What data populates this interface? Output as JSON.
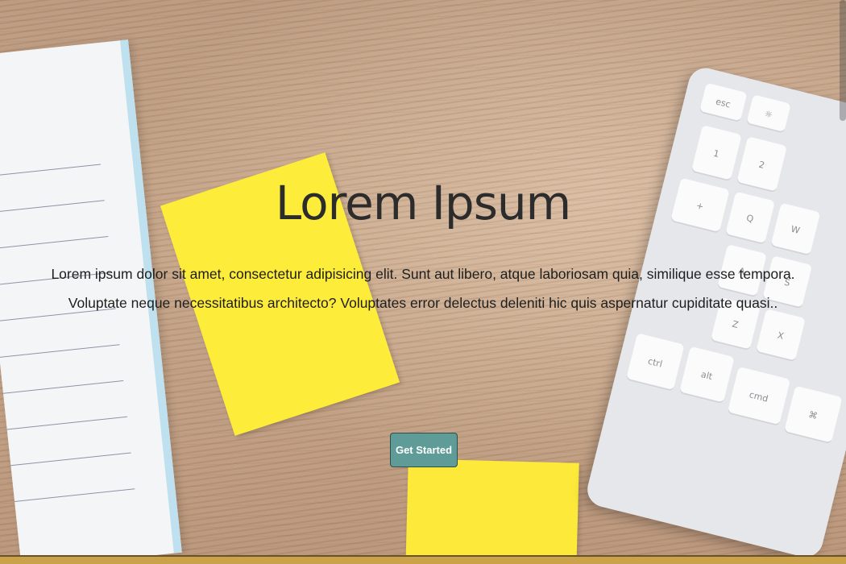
{
  "hero": {
    "title": "Lorem Ipsum",
    "description": "Lorem ipsum dolor sit amet, consectetur adipisicing elit. Sunt aut libero, atque laboriosam quia, similique esse tempora. Voluptate neque necessitatibus architecto? Voluptates error delectus deleniti hic quis aspernatur cupiditate quasi..",
    "cta_label": "Get Started"
  },
  "keyboard_keys": [
    "esc",
    "☼",
    "1",
    "2",
    "+",
    "Q",
    "W",
    "A",
    "S",
    "Z",
    "X",
    "ctrl",
    "alt",
    "cmd",
    "⌘"
  ],
  "colors": {
    "cta_background": "#5f9c97",
    "sticky_note": "#fdec3a",
    "footer_bar": "#caa24a",
    "title_text": "#2c2c2c"
  }
}
